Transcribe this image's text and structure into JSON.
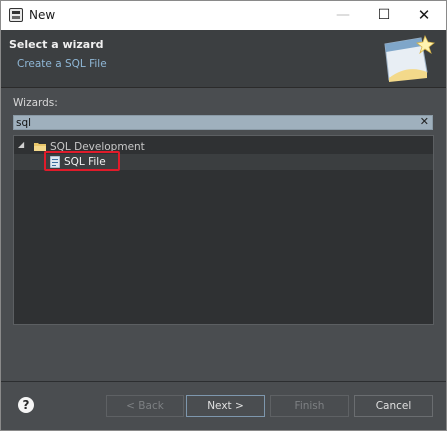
{
  "window": {
    "title": "New"
  },
  "banner": {
    "title": "Select a wizard",
    "subtitle": "Create a SQL File"
  },
  "wizards": {
    "label": "Wizards:",
    "filter_value": "sql",
    "tree": {
      "category": "SQL Development",
      "items": [
        "SQL File"
      ]
    }
  },
  "buttons": {
    "back": "< Back",
    "next": "Next >",
    "finish": "Finish",
    "cancel": "Cancel",
    "help": "?"
  },
  "colors": {
    "highlight": "#e01b2a",
    "link": "#8fb7d6"
  },
  "icons": [
    "app-icon",
    "minimize-icon",
    "maximize-icon",
    "close-icon",
    "wizard-banner-icon",
    "clear-icon",
    "expand-arrow-icon",
    "folder-icon",
    "sql-file-icon",
    "help-icon"
  ]
}
